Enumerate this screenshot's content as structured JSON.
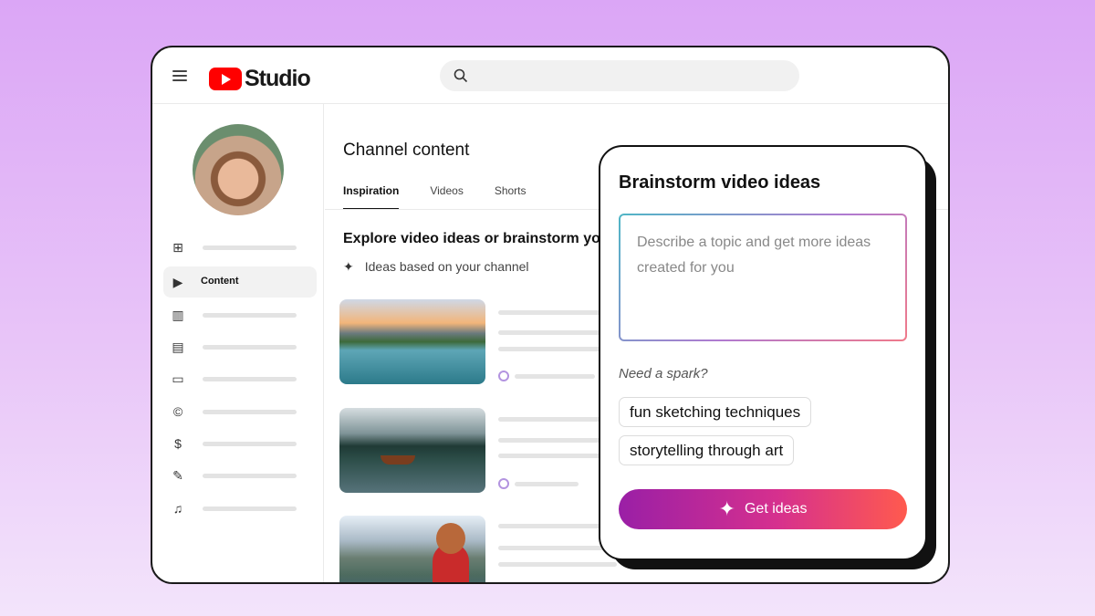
{
  "app": {
    "title": "Studio"
  },
  "search": {
    "placeholder": ""
  },
  "sidebar": {
    "items": [
      {
        "icon": "dashboard-icon",
        "label": ""
      },
      {
        "icon": "content-icon",
        "label": "Content"
      },
      {
        "icon": "analytics-icon",
        "label": ""
      },
      {
        "icon": "comments-icon",
        "label": ""
      },
      {
        "icon": "subtitles-icon",
        "label": ""
      },
      {
        "icon": "copyright-icon",
        "label": ""
      },
      {
        "icon": "earn-icon",
        "label": ""
      },
      {
        "icon": "customization-icon",
        "label": ""
      },
      {
        "icon": "audio-library-icon",
        "label": ""
      }
    ]
  },
  "main": {
    "page_title": "Channel content",
    "tabs": [
      {
        "label": "Inspiration",
        "active": true
      },
      {
        "label": "Videos",
        "active": false
      },
      {
        "label": "Shorts",
        "active": false
      }
    ],
    "explore_heading": "Explore video ideas or brainstorm you",
    "ideas_label": "Ideas based on your channel"
  },
  "brainstorm": {
    "title": "Brainstorm video ideas",
    "textarea_placeholder": "Describe a topic and get more ideas created for you",
    "spark_label": "Need a spark?",
    "suggestions": [
      "fun sketching techniques",
      "storytelling through art"
    ],
    "button_label": "Get ideas"
  },
  "colors": {
    "brand_red": "#ff0000",
    "button_start": "#9a1fa6",
    "button_end": "#ff5a4e"
  }
}
